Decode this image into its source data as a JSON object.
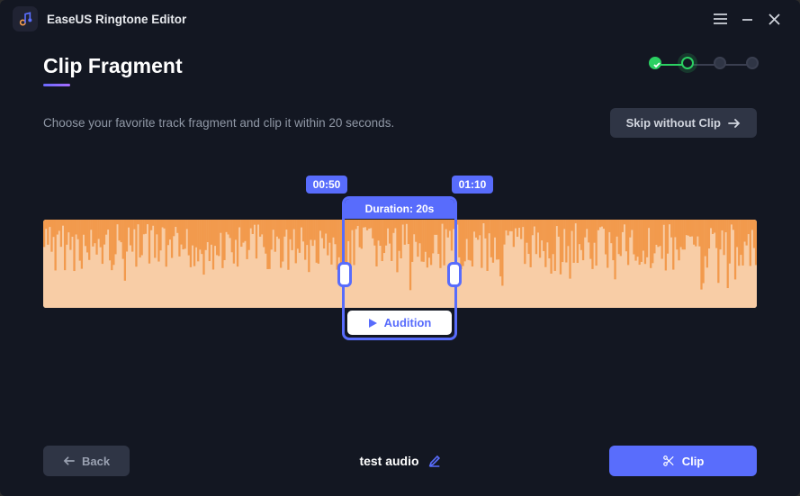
{
  "app": {
    "name": "EaseUS Ringtone Editor"
  },
  "page": {
    "title": "Clip Fragment",
    "subtitle": "Choose your favorite track fragment and clip it within 20 seconds.",
    "skip_label": "Skip without Clip"
  },
  "selection": {
    "start_ts": "00:50",
    "end_ts": "01:10",
    "duration_label": "Duration: 20s",
    "audition_label": "Audition"
  },
  "file": {
    "name": "test audio"
  },
  "buttons": {
    "back": "Back",
    "clip": "Clip"
  },
  "progress": {
    "total_steps": 4,
    "current_step": 2
  },
  "colors": {
    "accent_blue": "#586CFC",
    "accent_green": "#2BD062",
    "wave_dark": "#F29A4D",
    "wave_light": "#F8CDA6"
  }
}
